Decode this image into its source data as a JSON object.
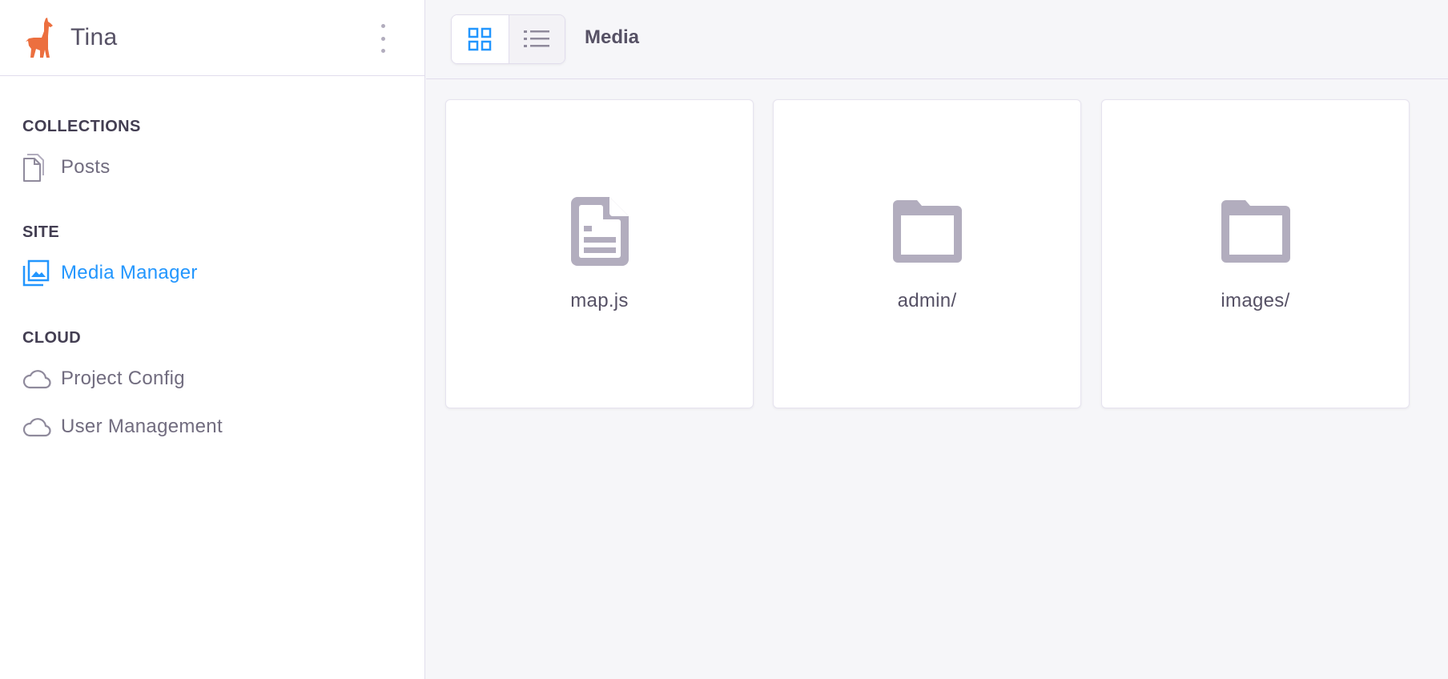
{
  "app": {
    "name": "Tina"
  },
  "sidebar": {
    "sections": [
      {
        "title": "COLLECTIONS",
        "items": [
          {
            "label": "Posts",
            "icon": "document-icon"
          }
        ]
      },
      {
        "title": "SITE",
        "items": [
          {
            "label": "Media Manager",
            "icon": "media-icon",
            "active": true
          }
        ]
      },
      {
        "title": "CLOUD",
        "items": [
          {
            "label": "Project Config",
            "icon": "cloud-icon"
          },
          {
            "label": "User Management",
            "icon": "cloud-icon"
          }
        ]
      }
    ]
  },
  "topbar": {
    "title": "Media",
    "view_modes": [
      "grid-view-icon",
      "list-view-icon"
    ],
    "active_view": "grid"
  },
  "files": [
    {
      "name": "map.js",
      "type": "file",
      "icon": "file-icon"
    },
    {
      "name": "admin/",
      "type": "folder",
      "icon": "folder-icon"
    },
    {
      "name": "images/",
      "type": "folder",
      "icon": "folder-icon"
    }
  ],
  "colors": {
    "accent": "#2296fe",
    "logo": "#ec6f3f",
    "icon_gray": "#b2adbe",
    "text_muted": "#716c7f"
  }
}
